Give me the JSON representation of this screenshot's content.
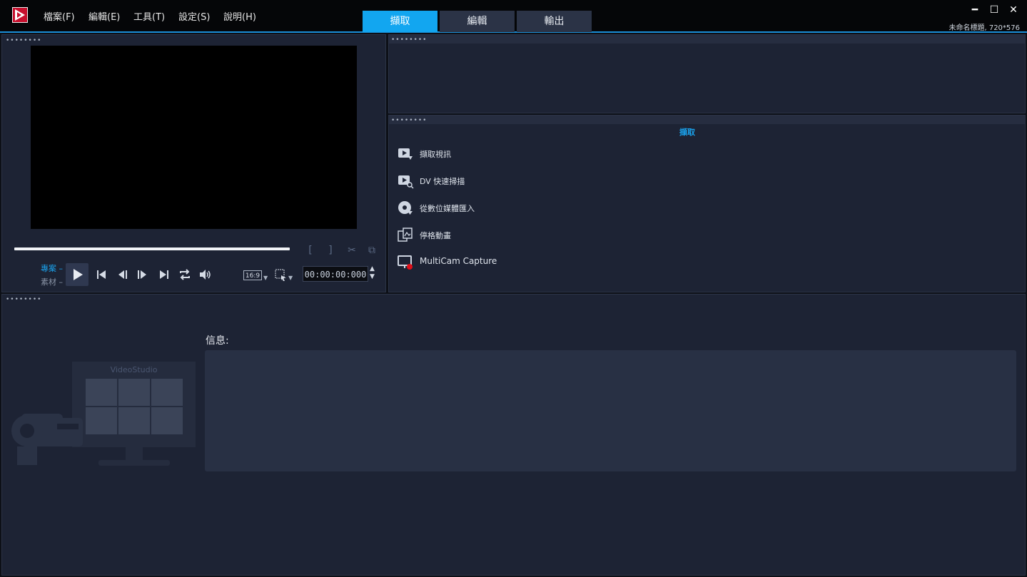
{
  "app": {
    "menu": [
      "檔案(F)",
      "編輯(E)",
      "工具(T)",
      "設定(S)",
      "說明(H)"
    ],
    "tabs": [
      "擷取",
      "編輯",
      "輸出"
    ],
    "active_tab": "擷取",
    "project_info": "未命名標題, 720*576",
    "accent": "#12a6f0"
  },
  "player": {
    "mode_project": "專案",
    "mode_clip": "素材",
    "aspect": "16:9",
    "timecode": "00:00:00:000"
  },
  "capture": {
    "heading": "擷取",
    "items": [
      {
        "label": "擷取視訊",
        "icon": "capture-video-icon"
      },
      {
        "label": "DV 快速掃描",
        "icon": "dv-scan-icon"
      },
      {
        "label": "從數位媒體匯入",
        "icon": "import-disc-icon"
      },
      {
        "label": "停格動畫",
        "icon": "stop-motion-icon"
      },
      {
        "label": "MultiCam Capture",
        "icon": "multicam-capture-icon"
      }
    ]
  },
  "info": {
    "label": "信息:",
    "illustration_title": "VideoStudio"
  }
}
